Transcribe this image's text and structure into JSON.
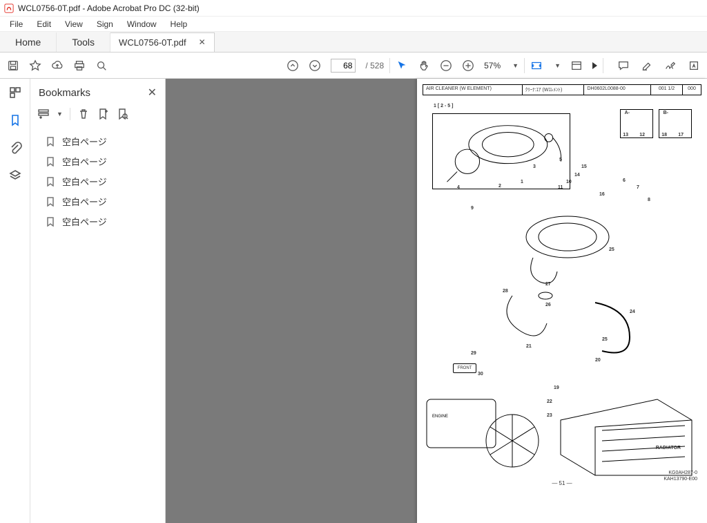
{
  "window": {
    "title": "WCL0756-0T.pdf - Adobe Acrobat Pro DC (32-bit)"
  },
  "menu": {
    "file": "File",
    "edit": "Edit",
    "view": "View",
    "sign": "Sign",
    "window": "Window",
    "help": "Help"
  },
  "tabs": {
    "home": "Home",
    "tools": "Tools",
    "doc": "WCL0756-0T.pdf"
  },
  "toolbar": {
    "page_current": "68",
    "page_total": "/ 528",
    "zoom": "57%"
  },
  "bookmarks": {
    "title": "Bookmarks",
    "items": [
      {
        "label": "空白ページ"
      },
      {
        "label": "空白ページ"
      },
      {
        "label": "空白ページ"
      },
      {
        "label": "空白ページ"
      },
      {
        "label": "空白ページ"
      }
    ]
  },
  "diagram": {
    "header": {
      "title": "AIR CLEANER (W ELEMENT)",
      "subtitle": "ｸﾘｰﾅ:ｴｱ (Wｴﾚﾒﾝﾄ)",
      "code": "DH0602L0088-00",
      "pages": "001  1/2",
      "end": "000"
    },
    "section": "1 [ 2 - 5 ]",
    "labels": {
      "engine": "ENGINE",
      "front": "FRONT",
      "radiator": "RADIATOR",
      "a_minus": "A-",
      "b_minus": "B-"
    },
    "callouts": [
      "1",
      "2",
      "3",
      "4",
      "5",
      "6",
      "7",
      "8",
      "9",
      "10",
      "11",
      "12",
      "13",
      "14",
      "15",
      "16",
      "17",
      "18",
      "19",
      "20",
      "21",
      "22",
      "23",
      "24",
      "25",
      "26",
      "27",
      "28",
      "29",
      "30"
    ],
    "footer_page": "— 51 —",
    "footer_codes": [
      "KG0AH287-0",
      "KAH13790-E00"
    ]
  }
}
